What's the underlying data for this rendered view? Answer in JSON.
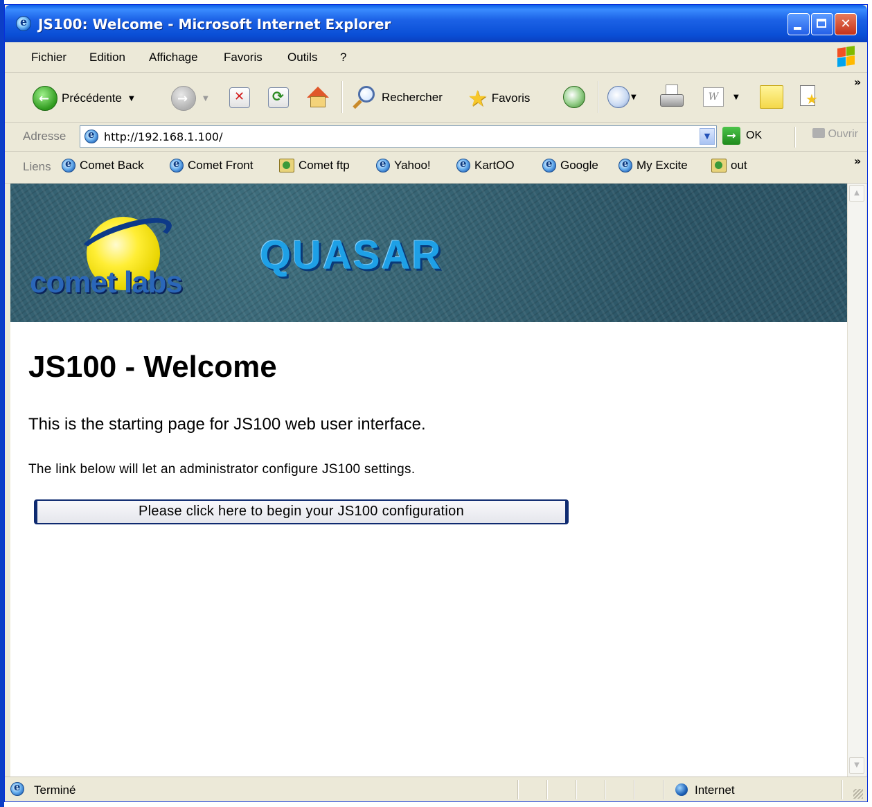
{
  "window": {
    "title": "JS100: Welcome - Microsoft Internet Explorer"
  },
  "menubar": {
    "items": [
      "Fichier",
      "Edition",
      "Affichage",
      "Favoris",
      "Outils",
      "?"
    ]
  },
  "toolbar": {
    "back_label": "Précédente",
    "search_label": "Rechercher",
    "favorites_label": "Favoris"
  },
  "address": {
    "label": "Adresse",
    "url": "http://192.168.1.100/",
    "go_label": "OK",
    "open_label": "Ouvrir"
  },
  "links": {
    "label": "Liens",
    "items": [
      "Comet Back",
      "Comet Front",
      "Comet ftp",
      "Yahoo!",
      "KartOO",
      "Google",
      "My Excite",
      "out"
    ]
  },
  "banner": {
    "brand": "comet labs",
    "product": "QUASAR"
  },
  "page": {
    "title": "JS100 - Welcome",
    "intro": "This is the starting page for JS100 web user interface.",
    "note": "The link below will let an administrator configure JS100 settings.",
    "config_button": "Please click here to begin your JS100 configuration"
  },
  "status": {
    "text": "Terminé",
    "zone": "Internet"
  },
  "colors": {
    "titlebar": "#0a4fd6",
    "chrome": "#ece9d8",
    "banner": "#2c5566",
    "button_border": "#0e2a70"
  },
  "icons": [
    "ie-icon",
    "back-arrow-icon",
    "forward-arrow-icon",
    "stop-icon",
    "refresh-icon",
    "home-icon",
    "search-icon",
    "favorites-star-icon",
    "history-icon",
    "mail-icon",
    "print-icon",
    "word-icon",
    "notes-icon",
    "messenger-icon",
    "go-arrow-icon",
    "globe-icon"
  ]
}
